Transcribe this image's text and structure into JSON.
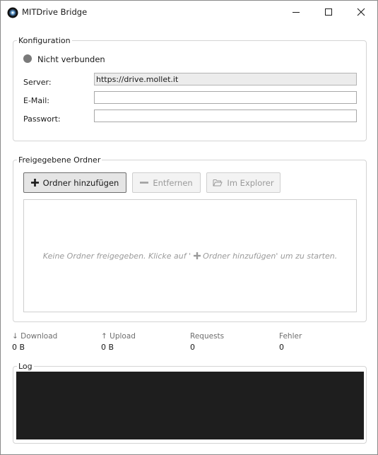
{
  "window": {
    "title": "MITDrive Bridge"
  },
  "config": {
    "legend": "Konfiguration",
    "status_text": "Nicht verbunden",
    "status_color": "#7a7a7a",
    "server_label": "Server:",
    "server_value": "https://drive.mollet.it",
    "email_label": "E-Mail:",
    "email_value": "",
    "password_label": "Passwort:",
    "password_value": ""
  },
  "folders": {
    "legend": "Freigegebene Ordner",
    "add_label": "Ordner hinzufügen",
    "remove_label": "Entfernen",
    "explorer_label": "Im Explorer",
    "empty_before": "Keine Ordner freigegeben. Klicke auf '",
    "empty_after": " Ordner hinzufügen' um zu starten."
  },
  "stats": {
    "download_label": "↓ Download",
    "download_value": "0 B",
    "upload_label": "↑ Upload",
    "upload_value": "0 B",
    "requests_label": "Requests",
    "requests_value": "0",
    "errors_label": "Fehler",
    "errors_value": "0"
  },
  "log": {
    "legend": "Log",
    "background": "#1e1e1e"
  },
  "icons": {
    "app": "app-icon",
    "minimize": "minimize-icon",
    "maximize": "maximize-icon",
    "close": "close-icon",
    "add": "plus-icon",
    "remove": "minus-icon",
    "explorer": "folder-open-icon"
  }
}
